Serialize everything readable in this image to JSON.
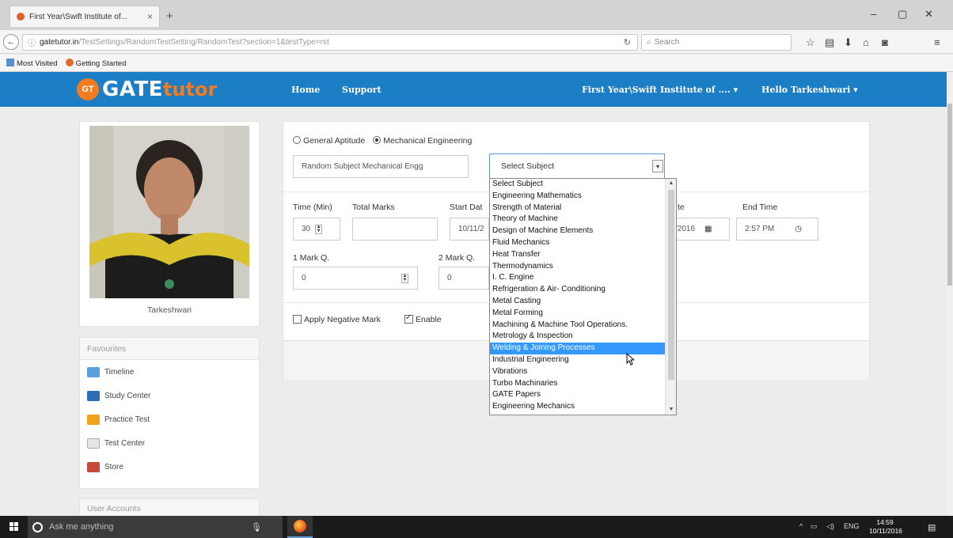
{
  "browser": {
    "tab_title": "First Year\\Swift Institute of...",
    "tab_close": "×",
    "new_tab": "+",
    "url_host": "gatetutor.in",
    "url_path": "/TestSettings/RandomTestSetting/RandomTest?section=1&testType=rst",
    "search_placeholder": "Search",
    "bookmarks": [
      "Most Visited",
      "Getting Started"
    ]
  },
  "header": {
    "logo_badge": "GT",
    "logo_gate": "GATE",
    "logo_tutor": "tutor",
    "nav": [
      "Home",
      "Support"
    ],
    "institute": "First Year\\Swift Institute of .... ▾",
    "user": "Hello Tarkeshwari ▾"
  },
  "profile": {
    "name": "Tarkeshwari"
  },
  "favourites": {
    "heading": "Favourites",
    "items": [
      "Timeline",
      "Study Center",
      "Practice Test",
      "Test Center",
      "Store"
    ]
  },
  "user_accounts": {
    "heading": "User Accounts"
  },
  "form": {
    "radio_general": "General Aptitude",
    "radio_mech": "Mechanical Engineering",
    "test_name": "Random Subject Mechanical Engg",
    "subject_select": "Select Subject",
    "labels": {
      "time": "Time (Min)",
      "total_marks": "Total Marks",
      "start_date": "Start Dat",
      "end_date": "te",
      "end_time": "End Time",
      "one_mark": "1 Mark Q.",
      "two_mark": "2 Mark Q."
    },
    "time_value": "30",
    "start_date_value": "10/11/2",
    "end_date_value": "/2016",
    "end_time_value": "2:57 PM",
    "one_mark_value": "0",
    "two_mark_value": "0",
    "negative_mark": "Apply Negative Mark",
    "enable": "Enable"
  },
  "dropdown": {
    "selected": "Welding & Joining Processes",
    "options": [
      "Select Subject",
      "Engineering Mathematics",
      "Strength of Material",
      "Theory of Machine",
      "Design of Machine Elements",
      "Fluid Mechanics",
      "Heat Transfer",
      "Thermodynamics",
      "I. C. Engine",
      "Refrigeration & Air- Conditioning",
      "Metal Casting",
      "Metal Forming",
      "Machining & Machine Tool Operations.",
      "Metrology & Inspection",
      "Welding & Joining Processes",
      "Industrial Engineering",
      "Vibrations",
      "Turbo Machinaries",
      "GATE Papers",
      "Engineering Mechanics"
    ]
  },
  "taskbar": {
    "search_placeholder": "Ask me anything",
    "lang": "ENG",
    "time": "14:59",
    "date": "10/11/2016"
  },
  "colors": {
    "header_blue": "#1c7ec5",
    "logo_orange": "#f47b20",
    "selection_blue": "#3399ff"
  }
}
